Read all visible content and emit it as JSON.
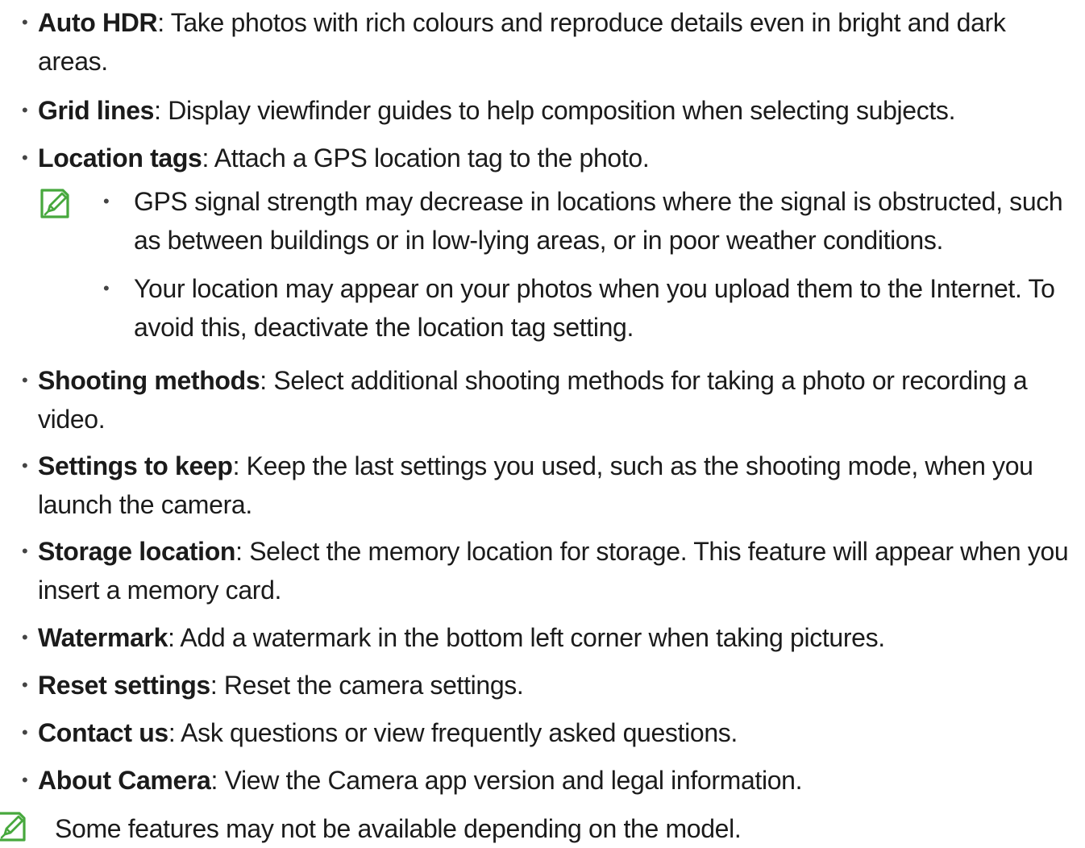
{
  "colors": {
    "note_icon": "#47a83d",
    "text": "#1b1b1b"
  },
  "bullet": "•",
  "items": [
    {
      "term": "Auto HDR",
      "description": ": Take photos with rich colours and reproduce details even in bright and dark areas."
    },
    {
      "term": "Grid lines",
      "description": ": Display viewfinder guides to help composition when selecting subjects."
    },
    {
      "term": "Location tags",
      "description": ": Attach a GPS location tag to the photo."
    },
    {
      "term": "Shooting methods",
      "description": ": Select additional shooting methods for taking a photo or recording a video."
    },
    {
      "term": "Settings to keep",
      "description": ": Keep the last settings you used, such as the shooting mode, when you launch the camera."
    },
    {
      "term": "Storage location",
      "description": ": Select the memory location for storage. This feature will appear when you insert a memory card."
    },
    {
      "term": "Watermark",
      "description": ": Add a watermark in the bottom left corner when taking pictures."
    },
    {
      "term": "Reset settings",
      "description": ": Reset the camera settings."
    },
    {
      "term": "Contact us",
      "description": ": Ask questions or view frequently asked questions."
    },
    {
      "term": "About Camera",
      "description": ": View the Camera app version and legal information."
    }
  ],
  "location_note": {
    "icon": "note-pencil-icon",
    "items": [
      "GPS signal strength may decrease in locations where the signal is obstructed, such as between buildings or in low-lying areas, or in poor weather conditions.",
      "Your location may appear on your photos when you upload them to the Internet. To avoid this, deactivate the location tag setting."
    ]
  },
  "footnote": {
    "icon": "note-pencil-icon",
    "text": "Some features may not be available depending on the model."
  }
}
